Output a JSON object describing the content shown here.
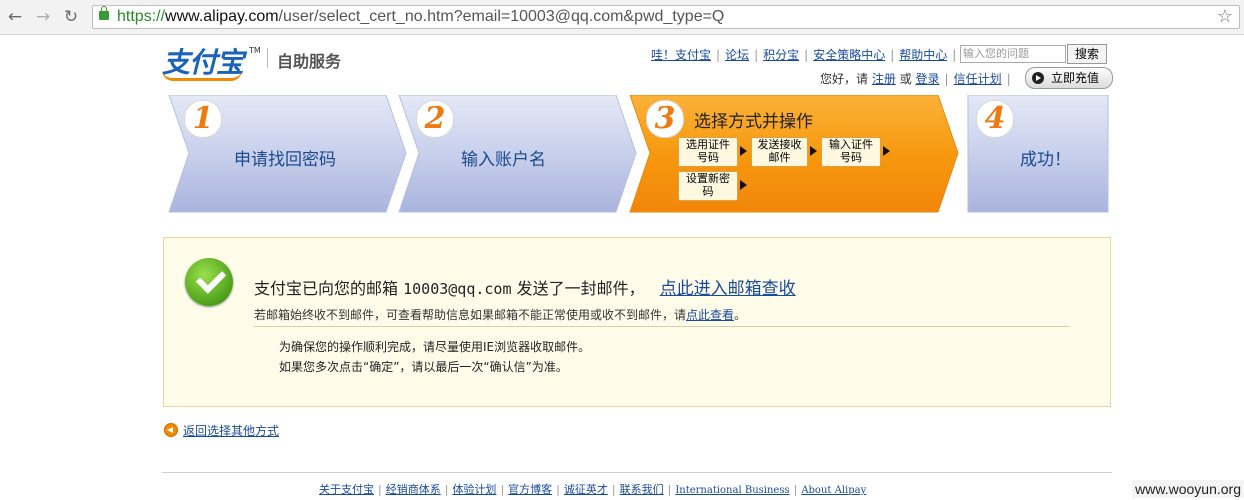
{
  "browser": {
    "back_icon": "back-arrow-icon",
    "forward_icon": "forward-arrow-icon",
    "reload_icon": "reload-icon",
    "url_scheme": "https://",
    "url_domain": "www.alipay.com",
    "url_path": "/user/select_cert_no.htm?email=10003@qq.com&pwd_type=Q"
  },
  "header": {
    "logo": "支付宝",
    "logo_tm": "TM",
    "service_title": "自助服务",
    "links": [
      "哇！支付宝",
      "论坛",
      "积分宝",
      "安全策略中心",
      "帮助中心"
    ],
    "search_placeholder": "输入您的问题",
    "search_button": "搜索",
    "greeting": "您好，请",
    "register": "注册",
    "or": "或",
    "login": "登录",
    "trust_plan": "信任计划",
    "recharge": "立即充值"
  },
  "steps": [
    {
      "number": "1",
      "label": "申请找回密码"
    },
    {
      "number": "2",
      "label": "输入账户名"
    },
    {
      "number": "3",
      "label": "选择方式并操作",
      "substeps": [
        "选用证件\n号码",
        "发送接收\n邮件",
        "输入证件\n号码",
        "设置新密\n码"
      ]
    },
    {
      "number": "4",
      "label": "成功！"
    }
  ],
  "message": {
    "main_prefix": "支付宝已向您的邮箱",
    "email": "10003@qq.com",
    "main_suffix": "发送了一封邮件，",
    "mailbox_link": "点此进入邮箱查收",
    "sub_text": "若邮箱始终收不到邮件，可查看帮助信息如果邮箱不能正常使用或收不到邮件，请",
    "sub_link": "点此查看",
    "sub_end": "。",
    "tip1": "为确保您的操作顺利完成，请尽量使用IE浏览器收取邮件。",
    "tip2": "如果您多次点击“确定”，请以最后一次“确认信”为准。"
  },
  "back_link": "返回选择其他方式",
  "footer_links": [
    "关于支付宝",
    "经销商体系",
    "体验计划",
    "官方博客",
    "诚征英才",
    "联系我们",
    "International Business",
    "About Alipay"
  ],
  "watermark": "www.wooyun.org",
  "colors": {
    "accent": "#f28a00",
    "link": "#1a4a9c",
    "step_blue": "#c3cbe8",
    "step_orange": "#f5960f"
  }
}
